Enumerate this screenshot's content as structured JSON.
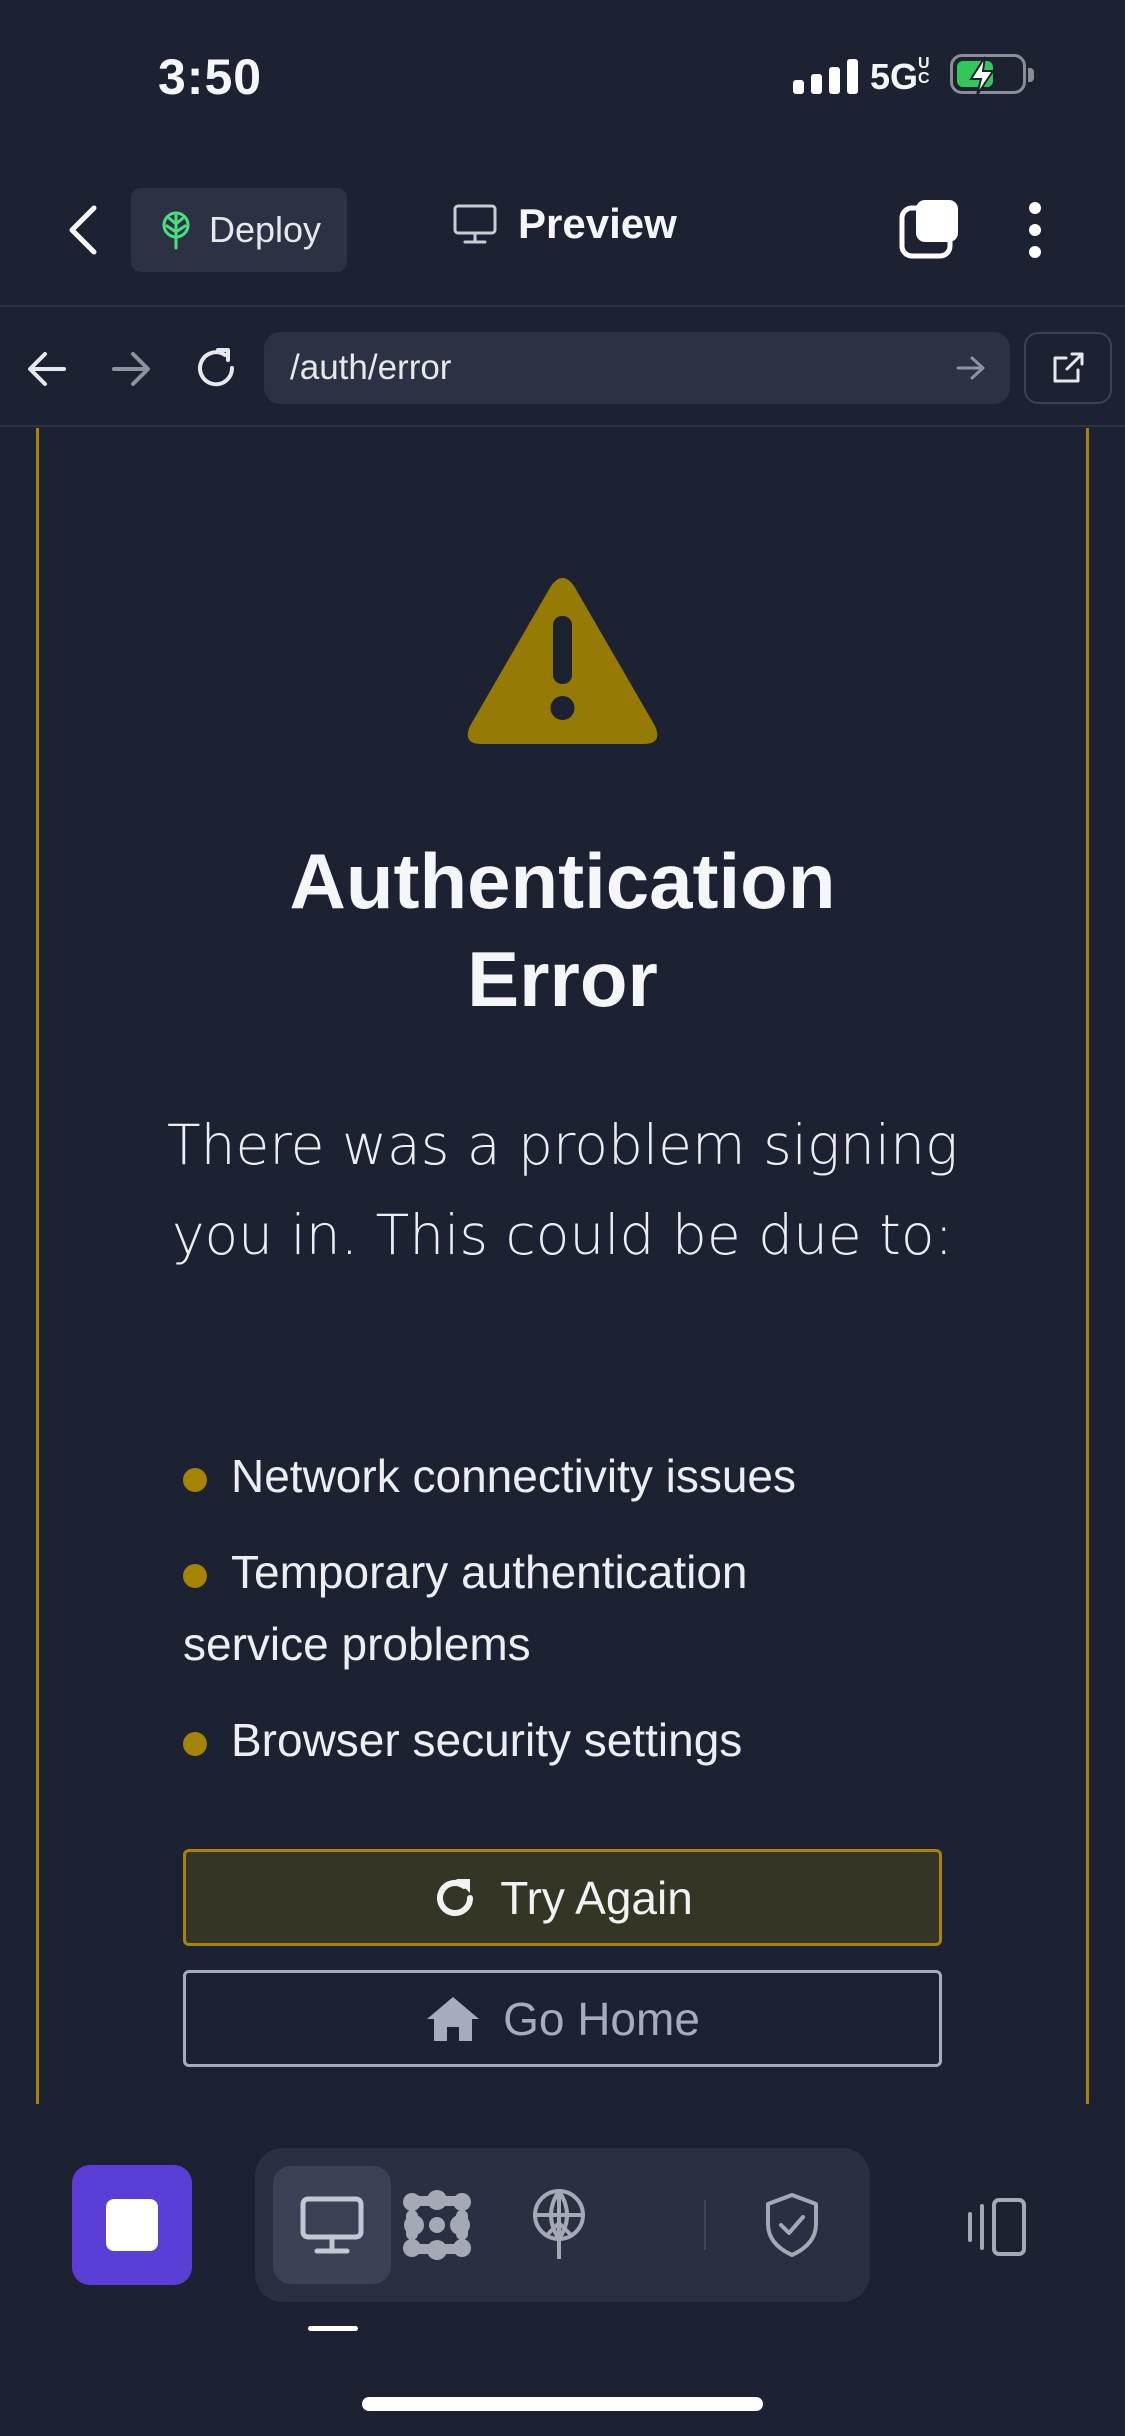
{
  "status_bar": {
    "time": "3:50",
    "network": "5G",
    "network_suffix": "UC",
    "icons": [
      "signal-icon",
      "battery-charging-icon"
    ]
  },
  "nav": {
    "back_icon": "chevron-left-icon",
    "deploy_label": "Deploy",
    "deploy_icon": "deploy-tree-icon",
    "preview_label": "Preview",
    "preview_icon": "monitor-icon",
    "tabs_icon": "tabs-icon",
    "menu_icon": "more-vertical-icon"
  },
  "browser": {
    "url": "/auth/error",
    "icons": [
      "arrow-left-icon",
      "arrow-right-icon",
      "reload-icon",
      "go-arrow-icon",
      "external-link-icon"
    ]
  },
  "content": {
    "warning_icon": "warning-triangle-icon",
    "title_line1": "Authentication",
    "title_line2": "Error",
    "description": "There was a problem signing you in. This could be due to:",
    "bullets": [
      "Network connectivity issues",
      "Temporary authentication service problems",
      "Browser security settings"
    ],
    "try_again_label": "Try Again",
    "go_home_label": "Go Home",
    "accent_color": "#a58408"
  },
  "toolbar": {
    "stop_icon": "stop-icon",
    "items": [
      "monitor-icon",
      "dots-grid-icon",
      "deploy-globe-icon",
      "shield-check-icon"
    ],
    "device_icon": "device-toggle-icon"
  }
}
